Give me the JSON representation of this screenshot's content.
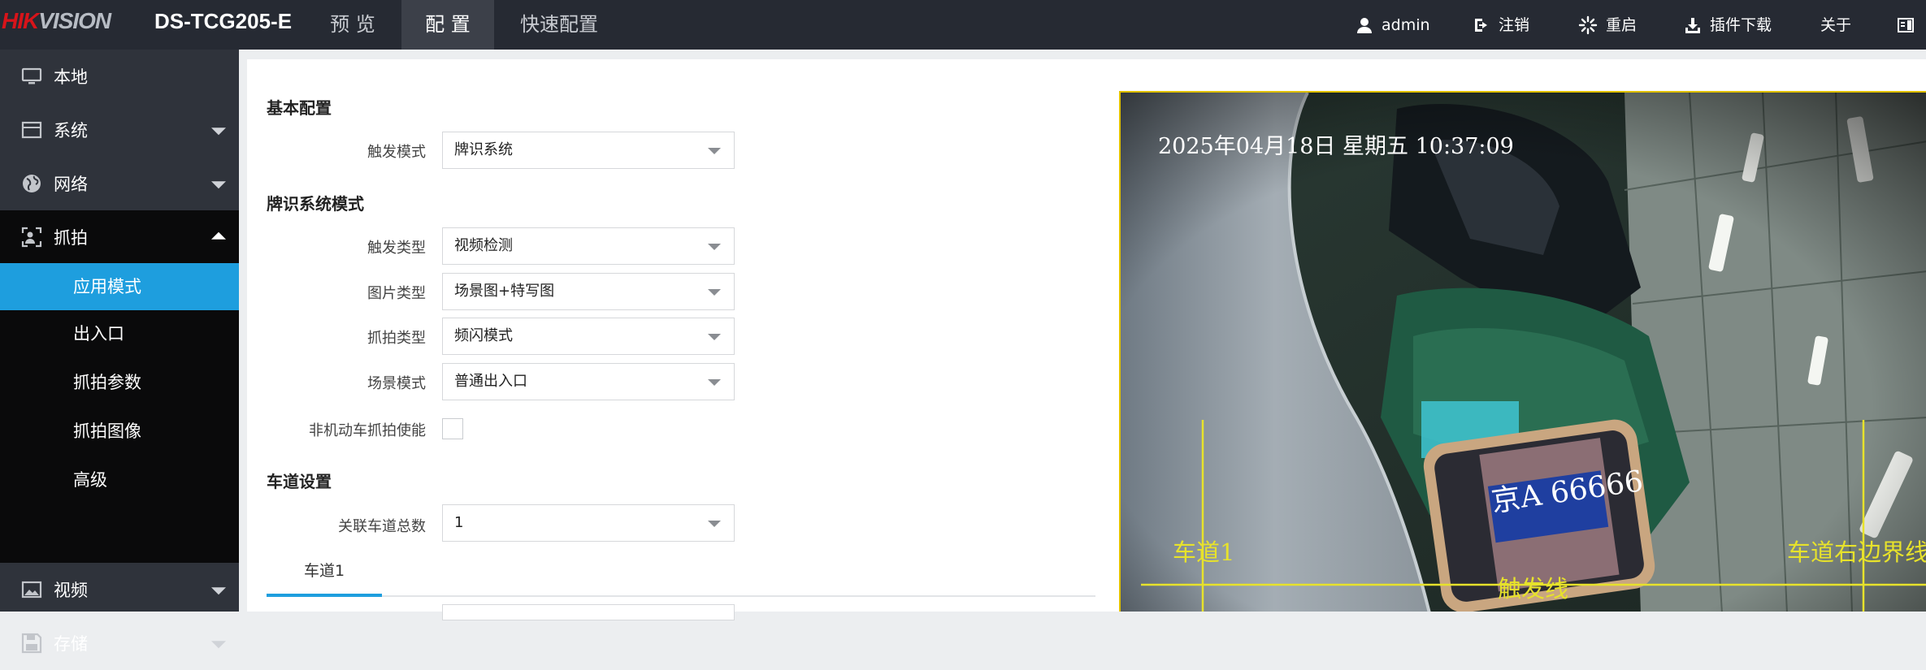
{
  "brand": {
    "logo_red": "HIK",
    "logo_grey": "VISION"
  },
  "header": {
    "device_model": "DS-TCG205-E",
    "nav_tabs": [
      {
        "label": "预 览"
      },
      {
        "label": "配 置"
      },
      {
        "label": "快速配置"
      }
    ],
    "active_tab": "配 置",
    "right_items": {
      "user": "admin",
      "logout": "注销",
      "reboot": "重启",
      "plugin": "插件下载",
      "about": "关于"
    }
  },
  "sidebar": {
    "items": [
      {
        "label": "本地",
        "icon": "monitor-icon"
      },
      {
        "label": "系统",
        "icon": "system-icon"
      },
      {
        "label": "网络",
        "icon": "globe-icon"
      },
      {
        "label": "抓拍",
        "icon": "capture-icon"
      },
      {
        "label": "视频",
        "icon": "image-icon"
      },
      {
        "label": "存储",
        "icon": "save-icon"
      }
    ],
    "capture_sub": [
      {
        "label": "应用模式"
      },
      {
        "label": "出入口"
      },
      {
        "label": "抓拍参数"
      },
      {
        "label": "抓拍图像"
      },
      {
        "label": "高级"
      }
    ],
    "active_sub": "应用模式"
  },
  "form": {
    "basic_title": "基本配置",
    "trigger_mode_label": "触发模式",
    "trigger_mode_value": "牌识系统",
    "lpr_title": "牌识系统模式",
    "trigger_type_label": "触发类型",
    "trigger_type_value": "视频检测",
    "image_type_label": "图片类型",
    "image_type_value": "场景图+特写图",
    "capture_type_label": "抓拍类型",
    "capture_type_value": "频闪模式",
    "scene_mode_label": "场景模式",
    "scene_mode_value": "普通出入口",
    "nonmotor_label": "非机动车抓拍使能",
    "lane_title": "车道设置",
    "lane_count_label": "关联车道总数",
    "lane_count_value": "1",
    "lane_tab": "车道1"
  },
  "video": {
    "osd_time": "2025年04月18日  星期五  10:37:09",
    "lane_label": "车道1",
    "right_boundary_label": "车道右边界线",
    "trigger_line_label": "触发线",
    "plate_text": "京A 66666",
    "overlay_color": "#e7e22b"
  },
  "colors": {
    "topbar": "#262a33",
    "sidebar": "#2f333b",
    "active_accent": "#1e9ede",
    "brand_red": "#d7141a"
  }
}
